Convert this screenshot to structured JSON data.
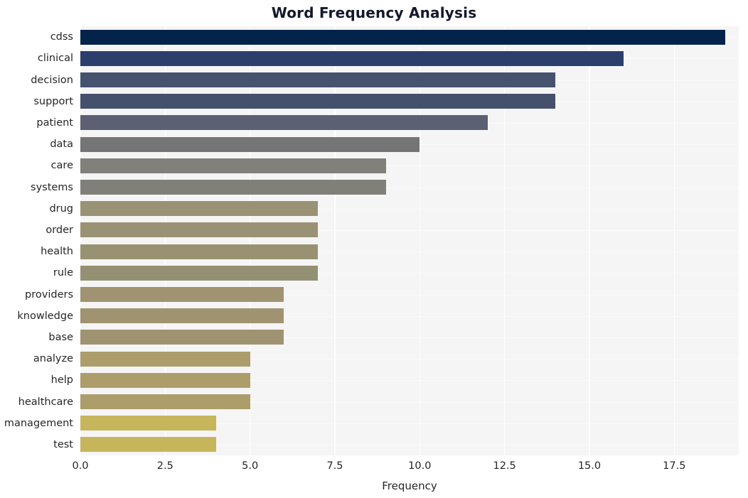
{
  "chart_data": {
    "type": "bar",
    "orientation": "horizontal",
    "title": "Word Frequency Analysis",
    "xlabel": "Frequency",
    "ylabel": "",
    "xlim": [
      0,
      19.4
    ],
    "ylim": null,
    "grid": true,
    "legend": null,
    "xticks": [
      "0.0",
      "2.5",
      "5.0",
      "7.5",
      "10.0",
      "12.5",
      "15.0",
      "17.5"
    ],
    "xtick_values": [
      0.0,
      2.5,
      5.0,
      7.5,
      10.0,
      12.5,
      15.0,
      17.5
    ],
    "categories": [
      "cdss",
      "clinical",
      "decision",
      "support",
      "patient",
      "data",
      "care",
      "systems",
      "drug",
      "order",
      "health",
      "rule",
      "providers",
      "knowledge",
      "base",
      "analyze",
      "help",
      "healthcare",
      "management",
      "test"
    ],
    "values": [
      19,
      16,
      14,
      14,
      12,
      10,
      9,
      9,
      7,
      7,
      7,
      7,
      6,
      6,
      6,
      5,
      5,
      5,
      4,
      4
    ],
    "bar_colors": [
      "#03234b",
      "#2c3e6b",
      "#46526e",
      "#44506c",
      "#5c6072",
      "#757575",
      "#82807a",
      "#817f79",
      "#9a9274",
      "#9a9274",
      "#989272",
      "#949073",
      "#a09371",
      "#a09371",
      "#a09371",
      "#ac9d6a",
      "#ac9d6a",
      "#ac9d6a",
      "#c6b55b",
      "#c6b55b"
    ],
    "plot_bgcolor": "#f5f5f6",
    "grid_color": "#ffffff",
    "title_color": "#13182b",
    "tick_color": "#262626"
  },
  "axis": {
    "x_label_text": "Frequency"
  }
}
